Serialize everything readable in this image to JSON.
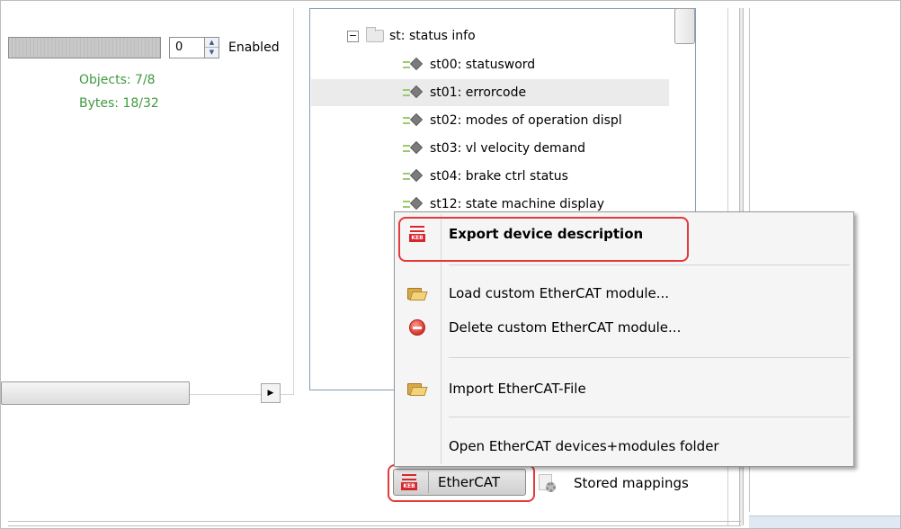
{
  "left_panel": {
    "spin_value": "0",
    "enabled_label": "Enabled",
    "objects_text": "Objects: 7/8",
    "bytes_text": "Bytes: 18/32"
  },
  "tree": {
    "group_label": "st: status info",
    "items": [
      {
        "label": "st00: statusword"
      },
      {
        "label": "st01: errorcode"
      },
      {
        "label": "st02: modes of operation displ"
      },
      {
        "label": "st03: vl velocity demand"
      },
      {
        "label": "st04: brake ctrl status"
      },
      {
        "label": "st12: state machine display"
      }
    ]
  },
  "context_menu": {
    "items": [
      {
        "label": "Export device description",
        "icon": "keb-export-icon"
      },
      {
        "label": "Load custom EtherCAT module...",
        "icon": "folder-open-icon"
      },
      {
        "label": "Delete custom EtherCAT module...",
        "icon": "delete-icon"
      },
      {
        "label": "Import EtherCAT-File",
        "icon": "folder-open-icon"
      },
      {
        "label": "Open EtherCAT devices+modules folder",
        "icon": ""
      }
    ]
  },
  "bottom_bar": {
    "ethercat_label": "EtherCAT",
    "stored_mappings_label": "Stored mappings"
  },
  "colors": {
    "highlight": "#e5393a",
    "stat_green": "#3f9a3f",
    "brand_red": "#d6272e"
  }
}
